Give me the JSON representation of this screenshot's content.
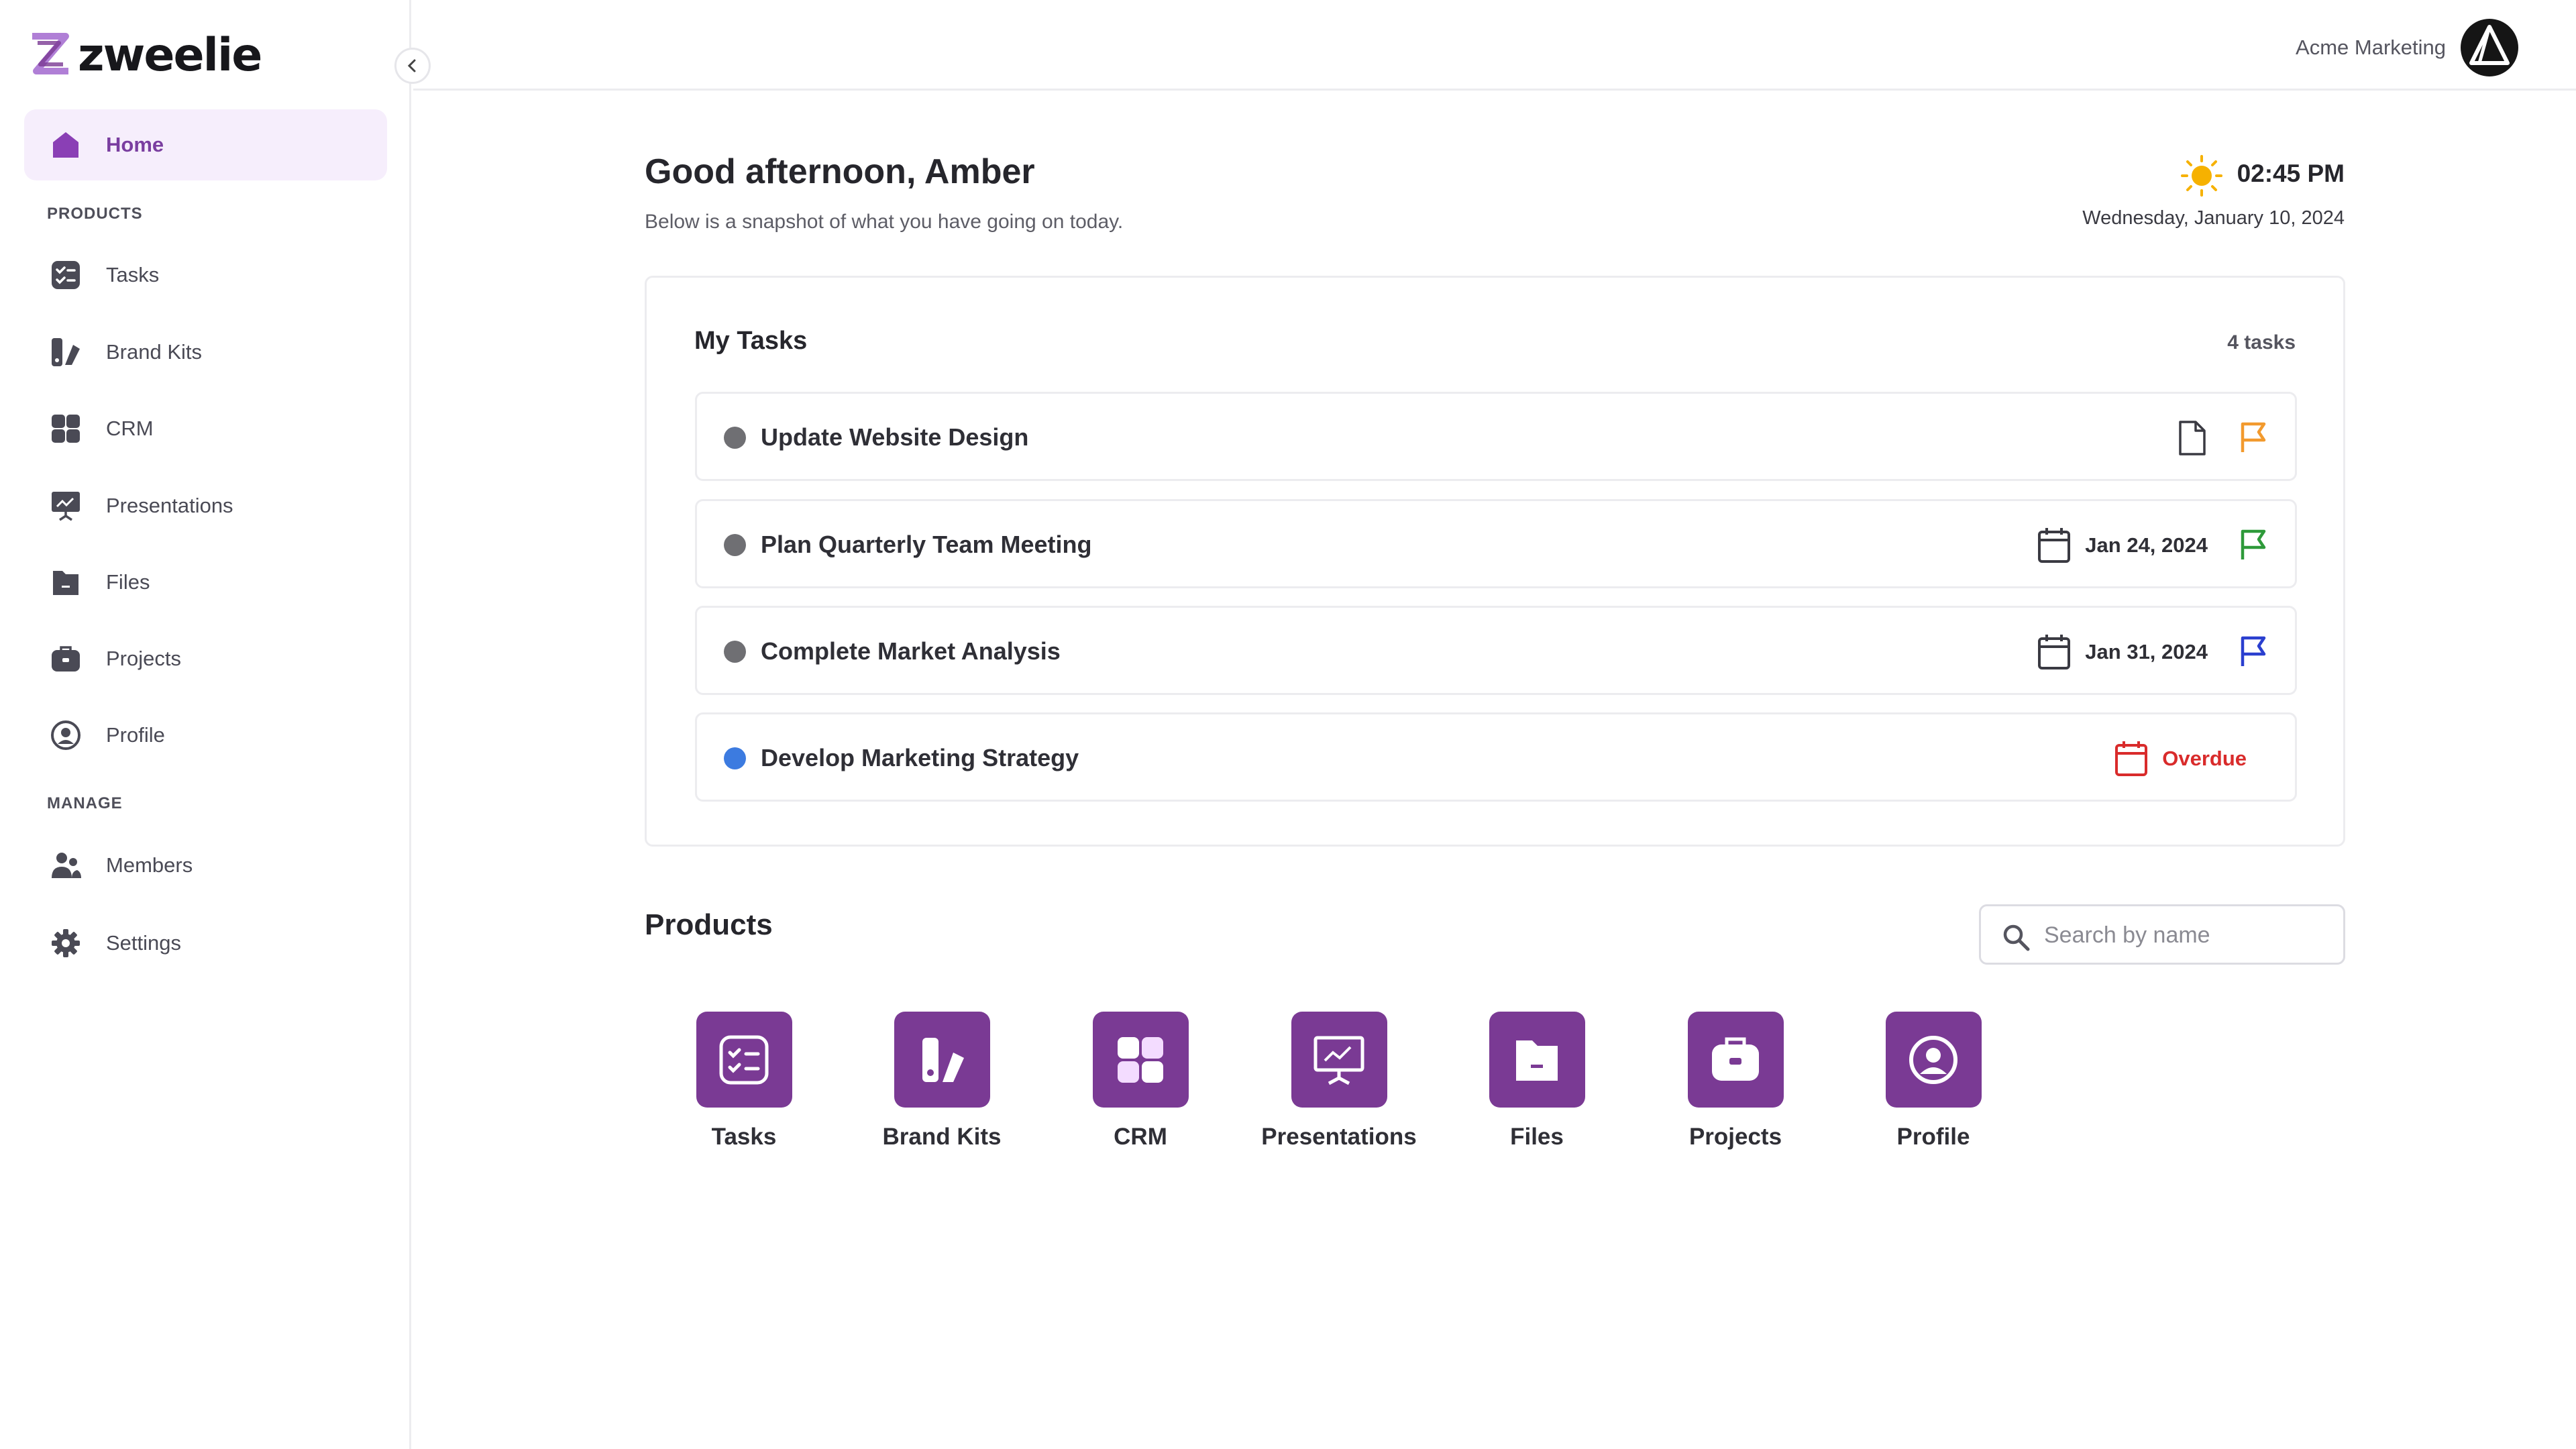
{
  "brand": {
    "name": "zweelie"
  },
  "sidebar": {
    "home_label": "Home",
    "products_section": "PRODUCTS",
    "manage_section": "MANAGE",
    "items": [
      {
        "label": "Tasks",
        "icon": "tasks-icon"
      },
      {
        "label": "Brand Kits",
        "icon": "brand-kits-icon"
      },
      {
        "label": "CRM",
        "icon": "crm-icon"
      },
      {
        "label": "Presentations",
        "icon": "presentations-icon"
      },
      {
        "label": "Files",
        "icon": "files-icon"
      },
      {
        "label": "Projects",
        "icon": "projects-icon"
      },
      {
        "label": "Profile",
        "icon": "profile-icon"
      }
    ],
    "manage_items": [
      {
        "label": "Members",
        "icon": "members-icon"
      },
      {
        "label": "Settings",
        "icon": "settings-icon"
      }
    ]
  },
  "header": {
    "org_name": "Acme Marketing"
  },
  "greeting": {
    "title": "Good afternoon, Amber",
    "subtitle": "Below is a snapshot of what you have going on today.",
    "time": "02:45 PM",
    "date": "Wednesday, January 10, 2024"
  },
  "tasks": {
    "title": "My Tasks",
    "count": "4 tasks",
    "items": [
      {
        "name": "Update Website Design",
        "due": "",
        "flag_color": "#f29a2e",
        "dot_color": "#6f6f73"
      },
      {
        "name": "Plan Quarterly Team Meeting",
        "due": "Jan 24, 2024",
        "flag_color": "#2e9a3a",
        "dot_color": "#6f6f73"
      },
      {
        "name": "Complete Market Analysis",
        "due": "Jan 31, 2024",
        "flag_color": "#2a3fcf",
        "dot_color": "#6f6f73"
      },
      {
        "name": "Develop Marketing Strategy",
        "due": "Overdue",
        "flag_color": "",
        "dot_color": "#3c7be0"
      }
    ]
  },
  "products": {
    "title": "Products",
    "search_placeholder": "Search by name",
    "items": [
      {
        "label": "Tasks"
      },
      {
        "label": "Brand Kits"
      },
      {
        "label": "CRM"
      },
      {
        "label": "Presentations"
      },
      {
        "label": "Files"
      },
      {
        "label": "Projects"
      },
      {
        "label": "Profile"
      }
    ]
  },
  "colors": {
    "accent": "#7a3a94",
    "active_bg": "#f6eefc",
    "overdue": "#d92b2b"
  }
}
